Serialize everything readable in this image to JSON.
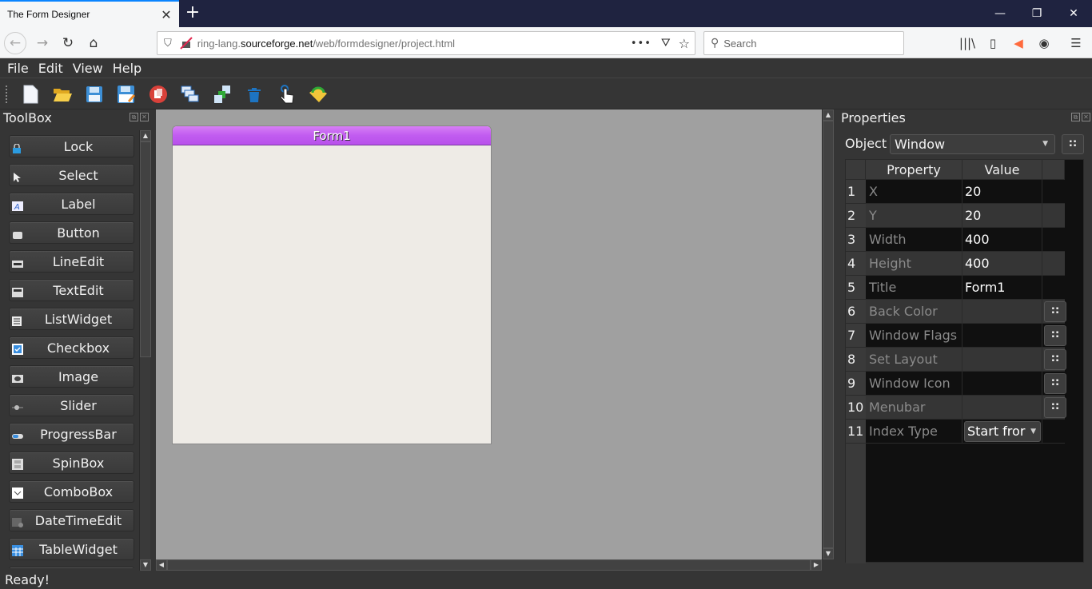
{
  "browser": {
    "tab_title": "The Form Designer",
    "url_prefix": "ring-lang.",
    "url_domain": "sourceforge.net",
    "url_path": "/web/formdesigner/project.html",
    "search_placeholder": "Search",
    "accent": "#0a84ff"
  },
  "app": {
    "menu": [
      "File",
      "Edit",
      "View",
      "Help"
    ],
    "toolbar": [
      "new-file",
      "open-folder",
      "save",
      "save-as",
      "close",
      "duplicate",
      "bring-to-front",
      "delete",
      "select",
      "load"
    ],
    "toolbox": {
      "title": "ToolBox",
      "items": [
        {
          "label": "Lock",
          "icon": "lock-icon"
        },
        {
          "label": "Select",
          "icon": "pointer-icon"
        },
        {
          "label": "Label",
          "icon": "label-icon"
        },
        {
          "label": "Button",
          "icon": "button-icon"
        },
        {
          "label": "LineEdit",
          "icon": "lineedit-icon"
        },
        {
          "label": "TextEdit",
          "icon": "textedit-icon"
        },
        {
          "label": "ListWidget",
          "icon": "listwidget-icon"
        },
        {
          "label": "Checkbox",
          "icon": "checkbox-icon"
        },
        {
          "label": "Image",
          "icon": "image-icon"
        },
        {
          "label": "Slider",
          "icon": "slider-icon"
        },
        {
          "label": "ProgressBar",
          "icon": "progressbar-icon"
        },
        {
          "label": "SpinBox",
          "icon": "spinbox-icon"
        },
        {
          "label": "ComboBox",
          "icon": "combobox-icon"
        },
        {
          "label": "DateTimeEdit",
          "icon": "datetime-icon"
        },
        {
          "label": "TableWidget",
          "icon": "table-icon"
        }
      ]
    },
    "form": {
      "title": "Form1",
      "title_color": "#c15cf0",
      "body_color": "#eeebe6"
    },
    "properties": {
      "title": "Properties",
      "object_label": "Object",
      "object_value": "Window",
      "dots_label": "::",
      "headers": {
        "property": "Property",
        "value": "Value"
      },
      "rows": [
        {
          "num": "1",
          "name": "X",
          "value": "20",
          "button": false
        },
        {
          "num": "2",
          "name": "Y",
          "value": "20",
          "button": false
        },
        {
          "num": "3",
          "name": "Width",
          "value": "400",
          "button": false
        },
        {
          "num": "4",
          "name": "Height",
          "value": "400",
          "button": false
        },
        {
          "num": "5",
          "name": "Title",
          "value": "Form1",
          "button": false
        },
        {
          "num": "6",
          "name": "Back Color",
          "value": "",
          "button": true
        },
        {
          "num": "7",
          "name": "Window Flags",
          "value": "",
          "button": true
        },
        {
          "num": "8",
          "name": "Set Layout",
          "value": "",
          "button": true
        },
        {
          "num": "9",
          "name": "Window Icon",
          "value": "",
          "button": true
        },
        {
          "num": "10",
          "name": "Menubar",
          "value": "",
          "button": true
        },
        {
          "num": "11",
          "name": "Index Type",
          "value": "Start fror",
          "button": false,
          "combo": true
        }
      ]
    },
    "status": "Ready!"
  }
}
